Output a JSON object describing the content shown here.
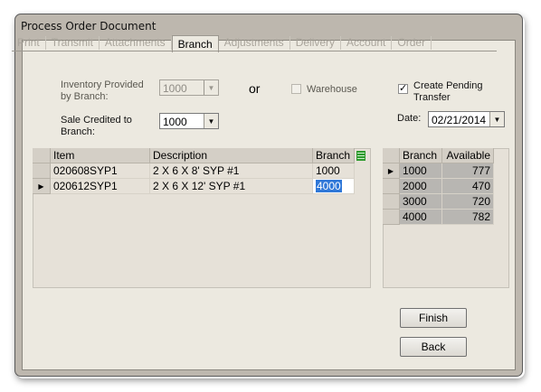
{
  "window": {
    "title": "Process Order Document"
  },
  "tabs": [
    {
      "label": "Print",
      "active": false
    },
    {
      "label": "Transmit",
      "active": false
    },
    {
      "label": "Attachments",
      "active": false
    },
    {
      "label": "Branch",
      "active": true
    },
    {
      "label": "Adjustments",
      "active": false
    },
    {
      "label": "Delivery",
      "active": false
    },
    {
      "label": "Account",
      "active": false
    },
    {
      "label": "Order",
      "active": false
    }
  ],
  "form": {
    "inventory_label": "Inventory Provided by Branch:",
    "inventory_value": "1000",
    "or_label": "or",
    "warehouse_label": "Warehouse",
    "warehouse_checked": false,
    "pending_label": "Create Pending Transfer",
    "pending_checked": true,
    "sale_label": "Sale Credited to Branch:",
    "sale_value": "1000",
    "date_label": "Date:",
    "date_value": "02/21/2014"
  },
  "items_grid": {
    "columns": [
      "Item",
      "Description",
      "Branch"
    ],
    "rows": [
      {
        "item": "020608SYP1",
        "description": "2 X 6 X 8' SYP #1",
        "branch": "1000"
      },
      {
        "item": "020612SYP1",
        "description": "2 X 6 X 12' SYP #1",
        "branch": "4000"
      }
    ],
    "current_row": 1
  },
  "branch_grid": {
    "columns": [
      "Branch",
      "Available"
    ],
    "rows": [
      {
        "branch": "1000",
        "available": "777"
      },
      {
        "branch": "2000",
        "available": "470"
      },
      {
        "branch": "3000",
        "available": "720"
      },
      {
        "branch": "4000",
        "available": "782"
      }
    ],
    "current_row": 0
  },
  "buttons": {
    "finish": "Finish",
    "back": "Back"
  },
  "icons": {
    "dropdown": "chevron-down-icon",
    "row_pointer": "row-pointer-icon",
    "columns": "column-chooser-icon"
  },
  "colors": {
    "client_bg": "#ece9e0",
    "selection": "#3078d8",
    "chrome": "#bdb7ae"
  }
}
